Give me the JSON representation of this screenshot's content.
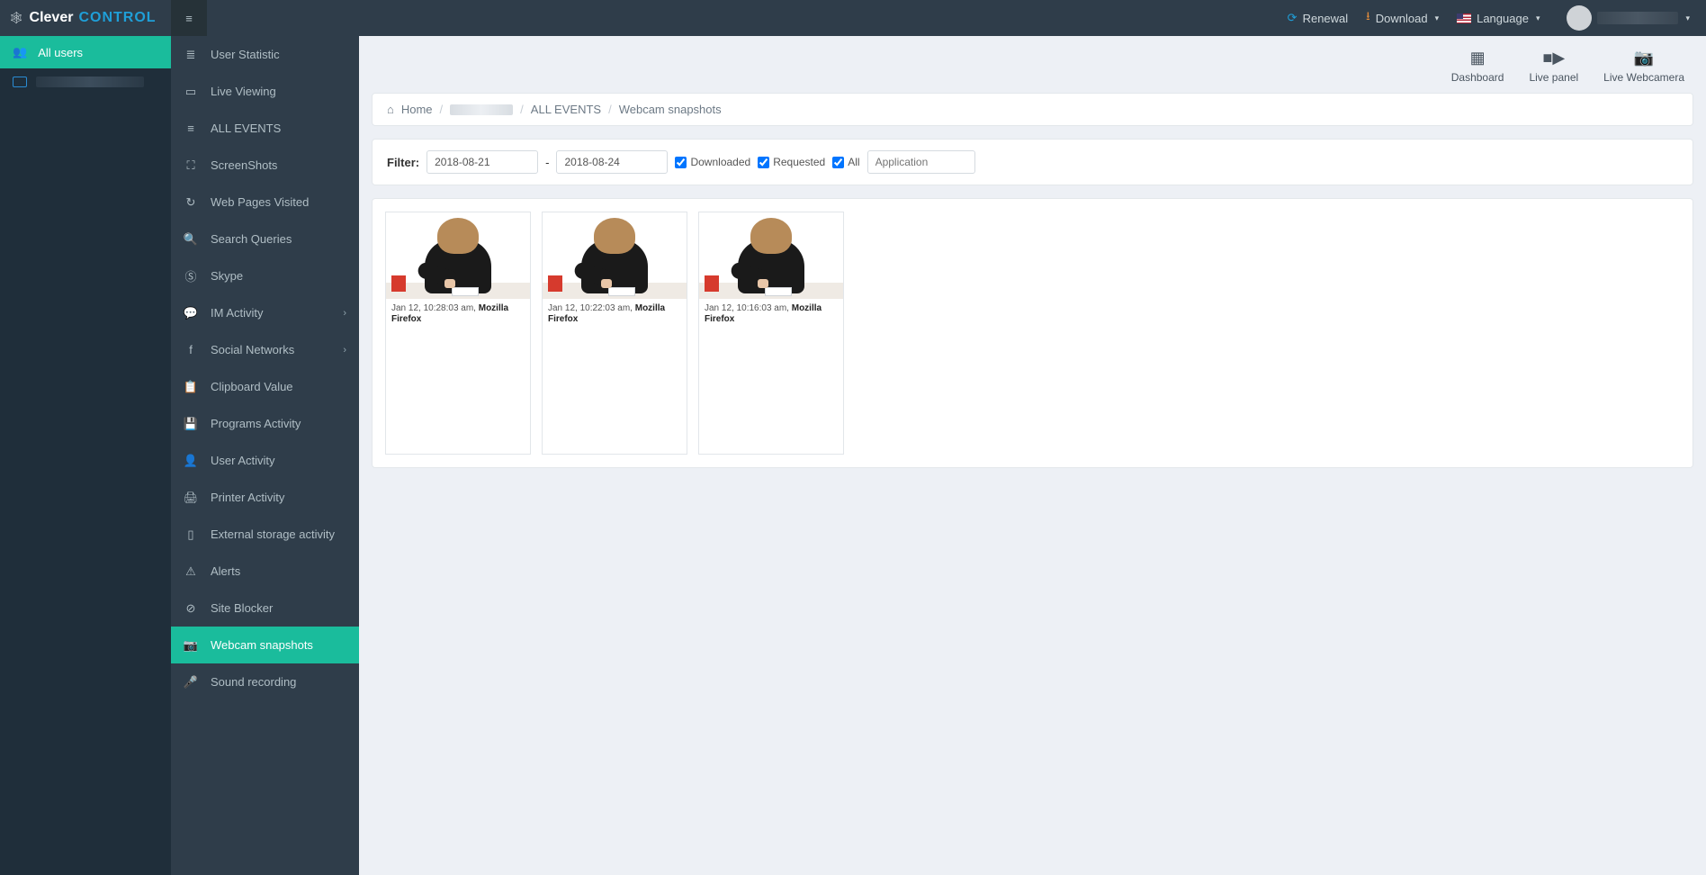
{
  "brand": {
    "part1": "Clever",
    "part2": "CONTROL"
  },
  "top": {
    "renewal": "Renewal",
    "download": "Download",
    "language": "Language"
  },
  "left": {
    "allusers": "All users"
  },
  "nav": {
    "items": [
      {
        "label": "User Statistic",
        "icon": "≣",
        "expand": false
      },
      {
        "label": "Live Viewing",
        "icon": "▭",
        "expand": false
      },
      {
        "label": "ALL EVENTS",
        "icon": "≡",
        "expand": false
      },
      {
        "label": "ScreenShots",
        "icon": "⛶",
        "expand": false
      },
      {
        "label": "Web Pages Visited",
        "icon": "↻",
        "expand": false
      },
      {
        "label": "Search Queries",
        "icon": "🔍",
        "expand": false
      },
      {
        "label": "Skype",
        "icon": "Ⓢ",
        "expand": false
      },
      {
        "label": "IM Activity",
        "icon": "💬",
        "expand": true
      },
      {
        "label": "Social Networks",
        "icon": "f",
        "expand": true
      },
      {
        "label": "Clipboard Value",
        "icon": "📋",
        "expand": false
      },
      {
        "label": "Programs Activity",
        "icon": "💾",
        "expand": false
      },
      {
        "label": "User Activity",
        "icon": "👤",
        "expand": false
      },
      {
        "label": "Printer Activity",
        "icon": "🖨",
        "expand": false
      },
      {
        "label": "External storage activity",
        "icon": "▯",
        "expand": false
      },
      {
        "label": "Alerts",
        "icon": "⚠",
        "expand": false
      },
      {
        "label": "Site Blocker",
        "icon": "⊘",
        "expand": false
      },
      {
        "label": "Webcam snapshots",
        "icon": "📷",
        "expand": false,
        "active": true
      },
      {
        "label": "Sound recording",
        "icon": "🎤",
        "expand": false
      }
    ]
  },
  "tabs": {
    "dashboard": "Dashboard",
    "livepanel": "Live panel",
    "livewebcam": "Live Webcamera"
  },
  "breadcrumb": {
    "home": "Home",
    "section": "ALL EVENTS",
    "page": "Webcam snapshots"
  },
  "filter": {
    "label": "Filter:",
    "from": "2018-08-21",
    "dash": "-",
    "to": "2018-08-24",
    "downloaded": "Downloaded",
    "requested": "Requested",
    "all": "All",
    "app_placeholder": "Application"
  },
  "snapshots": [
    {
      "time": "Jan 12, 10:28:03 am,",
      "app": "Mozilla Firefox"
    },
    {
      "time": "Jan 12, 10:22:03 am,",
      "app": "Mozilla Firefox"
    },
    {
      "time": "Jan 12, 10:16:03 am,",
      "app": "Mozilla Firefox"
    }
  ]
}
